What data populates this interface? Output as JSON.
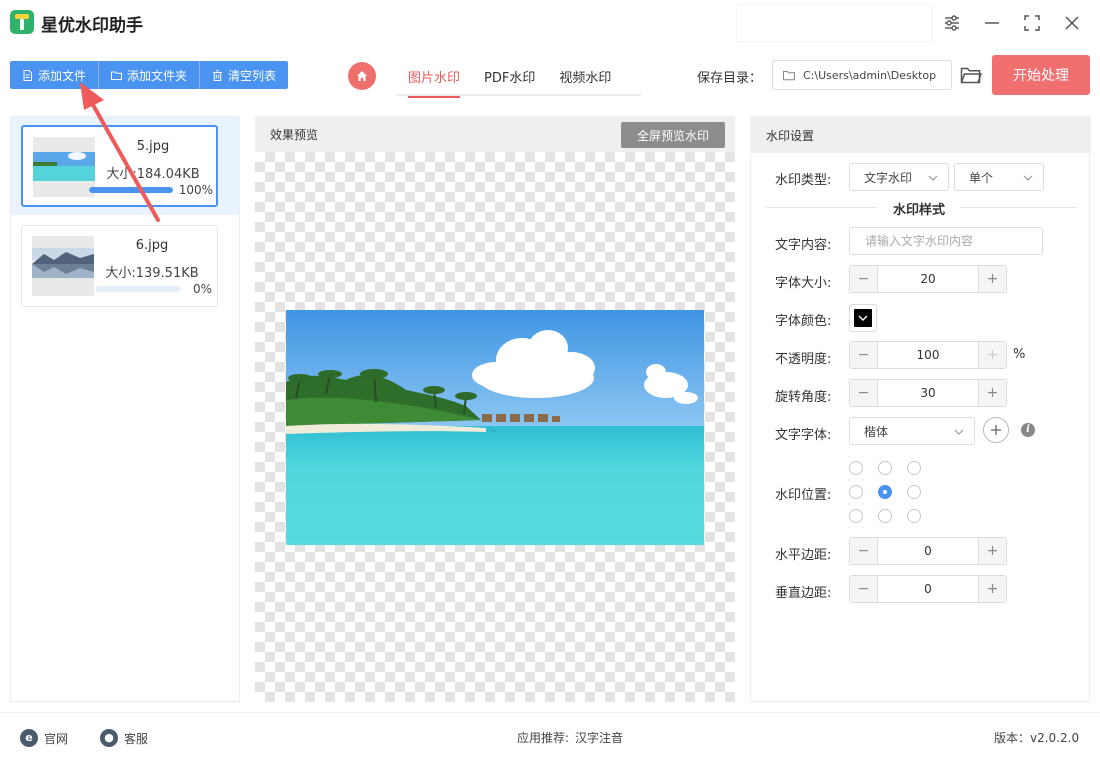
{
  "app": {
    "title": "星优水印助手"
  },
  "toolbar": {
    "add_file": "添加文件",
    "add_folder": "添加文件夹",
    "clear_list": "清空列表"
  },
  "tabs": [
    {
      "label": "图片水印",
      "active": true
    },
    {
      "label": "PDF水印",
      "active": false
    },
    {
      "label": "视频水印",
      "active": false
    }
  ],
  "save": {
    "label": "保存目录：",
    "path": "C:\\Users\\admin\\Desktop"
  },
  "start_button": "开始处理",
  "files": [
    {
      "name": "5.jpg",
      "size": "大小:184.04KB",
      "progress": 100,
      "progress_label": "100%",
      "selected": true
    },
    {
      "name": "6.jpg",
      "size": "大小:139.51KB",
      "progress": 0,
      "progress_label": "0%",
      "selected": false
    }
  ],
  "preview": {
    "title": "效果预览",
    "fullscreen_button": "全屏预览水印"
  },
  "settings": {
    "title": "水印设置",
    "type_label": "水印类型:",
    "type_value": "文字水印",
    "mode_value": "单个",
    "style_section": "水印样式",
    "text_label": "文字内容:",
    "text_placeholder": "请输入文字水印内容",
    "font_size_label": "字体大小:",
    "font_size_value": "20",
    "font_color_label": "字体颜色:",
    "font_color": "#000000",
    "opacity_label": "不透明度:",
    "opacity_value": "100",
    "opacity_unit": "%",
    "rotation_label": "旋转角度:",
    "rotation_value": "30",
    "font_label": "文字字体:",
    "font_value": "楷体",
    "position_label": "水印位置:",
    "position_selected": "middle-center",
    "h_margin_label": "水平边距:",
    "h_margin_value": "0",
    "v_margin_label": "垂直边距:",
    "v_margin_value": "0"
  },
  "footer": {
    "website": "官网",
    "support": "客服",
    "recommend_label": "应用推荐:",
    "recommend_app": "汉字注音",
    "version": "版本：v2.0.2.0"
  },
  "colors": {
    "accent_blue": "#4a93f0",
    "accent_red": "#f06f6f",
    "tab_active": "#e85c5c"
  }
}
